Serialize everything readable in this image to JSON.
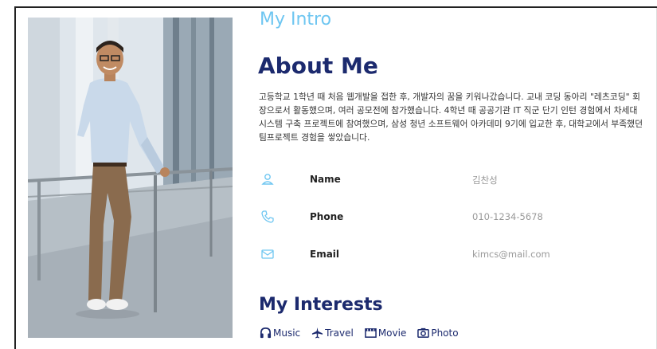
{
  "intro": {
    "section_label": "My Intro",
    "about_title": "About Me",
    "about_text": "고등학교 1학년 때 처음 웹개발을 접한 후, 개발자의 꿈을 키워나갔습니다. 교내 코딩 동아리 \"레츠코딩\" 회장으로서 활동했으며, 여러 공모전에 참가했습니다. 4학년 때 공공기관 IT 직군 단기 인턴 경험에서 차세대 시스템 구축 프로젝트에 참여했으며, 삼성 청년 소프트웨어 아카데미 9기에 입교한 후, 대학교에서 부족했던 팀프로젝트 경험을 쌓았습니다."
  },
  "info": {
    "name_label": "Name",
    "name_value": "김찬성",
    "phone_label": "Phone",
    "phone_value": "010-1234-5678",
    "email_label": "Email",
    "email_value": "kimcs@mail.com"
  },
  "interests": {
    "title": "My Interests",
    "items": [
      {
        "label": "Music",
        "icon": "headphones-icon"
      },
      {
        "label": "Travel",
        "icon": "airplane-icon"
      },
      {
        "label": "Movie",
        "icon": "film-icon"
      },
      {
        "label": "Photo",
        "icon": "camera-icon"
      }
    ]
  },
  "colors": {
    "accent_light": "#6ec6f1",
    "title_navy": "#1c2a6e",
    "value_gray": "#999999"
  }
}
